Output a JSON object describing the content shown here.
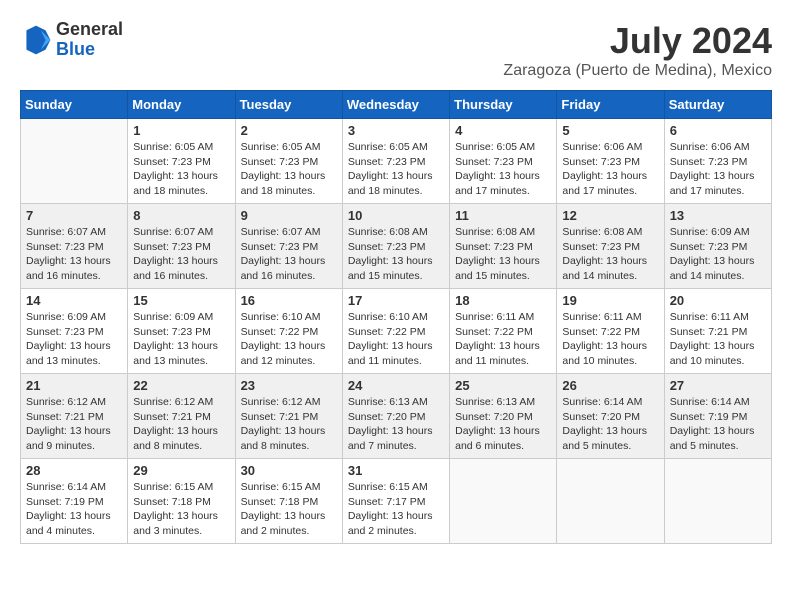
{
  "logo": {
    "general": "General",
    "blue": "Blue"
  },
  "title": {
    "month_year": "July 2024",
    "location": "Zaragoza (Puerto de Medina), Mexico"
  },
  "weekdays": [
    "Sunday",
    "Monday",
    "Tuesday",
    "Wednesday",
    "Thursday",
    "Friday",
    "Saturday"
  ],
  "weeks": [
    [
      {
        "day": "",
        "empty": true
      },
      {
        "day": "1",
        "sunrise": "6:05 AM",
        "sunset": "7:23 PM",
        "daylight": "13 hours and 18 minutes."
      },
      {
        "day": "2",
        "sunrise": "6:05 AM",
        "sunset": "7:23 PM",
        "daylight": "13 hours and 18 minutes."
      },
      {
        "day": "3",
        "sunrise": "6:05 AM",
        "sunset": "7:23 PM",
        "daylight": "13 hours and 18 minutes."
      },
      {
        "day": "4",
        "sunrise": "6:05 AM",
        "sunset": "7:23 PM",
        "daylight": "13 hours and 17 minutes."
      },
      {
        "day": "5",
        "sunrise": "6:06 AM",
        "sunset": "7:23 PM",
        "daylight": "13 hours and 17 minutes."
      },
      {
        "day": "6",
        "sunrise": "6:06 AM",
        "sunset": "7:23 PM",
        "daylight": "13 hours and 17 minutes."
      }
    ],
    [
      {
        "day": "7",
        "sunrise": "6:07 AM",
        "sunset": "7:23 PM",
        "daylight": "13 hours and 16 minutes."
      },
      {
        "day": "8",
        "sunrise": "6:07 AM",
        "sunset": "7:23 PM",
        "daylight": "13 hours and 16 minutes."
      },
      {
        "day": "9",
        "sunrise": "6:07 AM",
        "sunset": "7:23 PM",
        "daylight": "13 hours and 16 minutes."
      },
      {
        "day": "10",
        "sunrise": "6:08 AM",
        "sunset": "7:23 PM",
        "daylight": "13 hours and 15 minutes."
      },
      {
        "day": "11",
        "sunrise": "6:08 AM",
        "sunset": "7:23 PM",
        "daylight": "13 hours and 15 minutes."
      },
      {
        "day": "12",
        "sunrise": "6:08 AM",
        "sunset": "7:23 PM",
        "daylight": "13 hours and 14 minutes."
      },
      {
        "day": "13",
        "sunrise": "6:09 AM",
        "sunset": "7:23 PM",
        "daylight": "13 hours and 14 minutes."
      }
    ],
    [
      {
        "day": "14",
        "sunrise": "6:09 AM",
        "sunset": "7:23 PM",
        "daylight": "13 hours and 13 minutes."
      },
      {
        "day": "15",
        "sunrise": "6:09 AM",
        "sunset": "7:23 PM",
        "daylight": "13 hours and 13 minutes."
      },
      {
        "day": "16",
        "sunrise": "6:10 AM",
        "sunset": "7:22 PM",
        "daylight": "13 hours and 12 minutes."
      },
      {
        "day": "17",
        "sunrise": "6:10 AM",
        "sunset": "7:22 PM",
        "daylight": "13 hours and 11 minutes."
      },
      {
        "day": "18",
        "sunrise": "6:11 AM",
        "sunset": "7:22 PM",
        "daylight": "13 hours and 11 minutes."
      },
      {
        "day": "19",
        "sunrise": "6:11 AM",
        "sunset": "7:22 PM",
        "daylight": "13 hours and 10 minutes."
      },
      {
        "day": "20",
        "sunrise": "6:11 AM",
        "sunset": "7:21 PM",
        "daylight": "13 hours and 10 minutes."
      }
    ],
    [
      {
        "day": "21",
        "sunrise": "6:12 AM",
        "sunset": "7:21 PM",
        "daylight": "13 hours and 9 minutes."
      },
      {
        "day": "22",
        "sunrise": "6:12 AM",
        "sunset": "7:21 PM",
        "daylight": "13 hours and 8 minutes."
      },
      {
        "day": "23",
        "sunrise": "6:12 AM",
        "sunset": "7:21 PM",
        "daylight": "13 hours and 8 minutes."
      },
      {
        "day": "24",
        "sunrise": "6:13 AM",
        "sunset": "7:20 PM",
        "daylight": "13 hours and 7 minutes."
      },
      {
        "day": "25",
        "sunrise": "6:13 AM",
        "sunset": "7:20 PM",
        "daylight": "13 hours and 6 minutes."
      },
      {
        "day": "26",
        "sunrise": "6:14 AM",
        "sunset": "7:20 PM",
        "daylight": "13 hours and 5 minutes."
      },
      {
        "day": "27",
        "sunrise": "6:14 AM",
        "sunset": "7:19 PM",
        "daylight": "13 hours and 5 minutes."
      }
    ],
    [
      {
        "day": "28",
        "sunrise": "6:14 AM",
        "sunset": "7:19 PM",
        "daylight": "13 hours and 4 minutes."
      },
      {
        "day": "29",
        "sunrise": "6:15 AM",
        "sunset": "7:18 PM",
        "daylight": "13 hours and 3 minutes."
      },
      {
        "day": "30",
        "sunrise": "6:15 AM",
        "sunset": "7:18 PM",
        "daylight": "13 hours and 2 minutes."
      },
      {
        "day": "31",
        "sunrise": "6:15 AM",
        "sunset": "7:17 PM",
        "daylight": "13 hours and 2 minutes."
      },
      {
        "day": "",
        "empty": true
      },
      {
        "day": "",
        "empty": true
      },
      {
        "day": "",
        "empty": true
      }
    ]
  ]
}
